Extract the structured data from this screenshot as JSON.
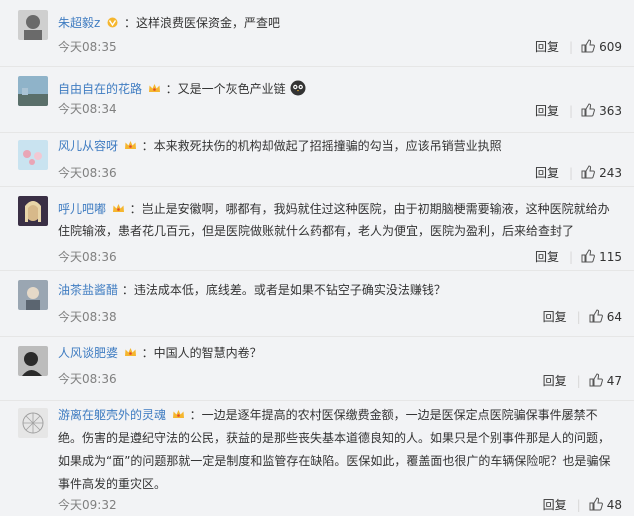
{
  "comments": [
    {
      "user": "朱超毅z",
      "badge": "v",
      "text": "：这样浪费医保资金，严查吧",
      "time": "今天08:35",
      "reply": "回复",
      "likes": "609",
      "avatar_colors": [
        "#6a6a6a",
        "#cfcfcf"
      ]
    },
    {
      "user": "自由自在的花路",
      "badge": "crown",
      "text": "：又是一个灰色产业链",
      "emoji": "owl-emoji",
      "time": "今天08:34",
      "reply": "回复",
      "likes": "363",
      "avatar_colors": [
        "#8fb3c9",
        "#5a6f6a"
      ]
    },
    {
      "user": "风儿从容呀",
      "badge": "crown",
      "text": "：本来救死扶伤的机构却做起了招摇撞骗的勾当，应该吊销营业执照",
      "time": "今天08:36",
      "reply": "回复",
      "likes": "243",
      "avatar_colors": [
        "#c9e3f0",
        "#e9a6b6"
      ]
    },
    {
      "user": "呼儿吧嘟",
      "badge": "crown",
      "text": "：岂止是安徽啊，哪都有，我妈就住过这种医院，由于初期脑梗需要输液，这种医院就给办住院输液，患者花几百元，但是医院做账就什么药都有，老人为便宜，医院为盈利，后来给查封了",
      "time": "今天08:36",
      "reply": "回复",
      "likes": "115",
      "avatar_colors": [
        "#3a2f45",
        "#d7b98a"
      ]
    },
    {
      "user": "油茶盐酱醋",
      "badge": "",
      "text": "：违法成本低，底线差。或者是如果不钻空子确实没法赚钱？",
      "time": "今天08:38",
      "reply": "回复",
      "likes": "64",
      "avatar_colors": [
        "#9aa6b2",
        "#5b6570"
      ]
    },
    {
      "user": "人风谈肥婆",
      "badge": "crown",
      "text": "：中国人的智慧内卷？",
      "time": "今天08:36",
      "reply": "回复",
      "likes": "47",
      "avatar_colors": [
        "#2b2b2b",
        "#bcbcbc"
      ]
    },
    {
      "user": "游离在躯壳外的灵魂",
      "badge": "crown",
      "text": "：一边是逐年提高的农村医保缴费金额，一边是医保定点医院骗保事件屡禁不绝。伤害的是遵纪守法的公民，获益的是那些丧失基本道德良知的人。如果只是个别事件那是人的问题，如果成为“面”的问题那就一定是制度和监管存在缺陷。医保如此，覆盖面也很广的车辆保险呢？也是骗保事件高发的重灾区。",
      "time": "今天09:32",
      "reply": "回复",
      "likes": "48",
      "avatar_colors": [
        "#e6e6e6",
        "#a0a0a0"
      ]
    }
  ],
  "colors": {
    "background": "#f2f3f5",
    "username": "#eb7350",
    "username_link": "#3f7cc1",
    "time": "#808080",
    "crown": "#f5b62f"
  }
}
